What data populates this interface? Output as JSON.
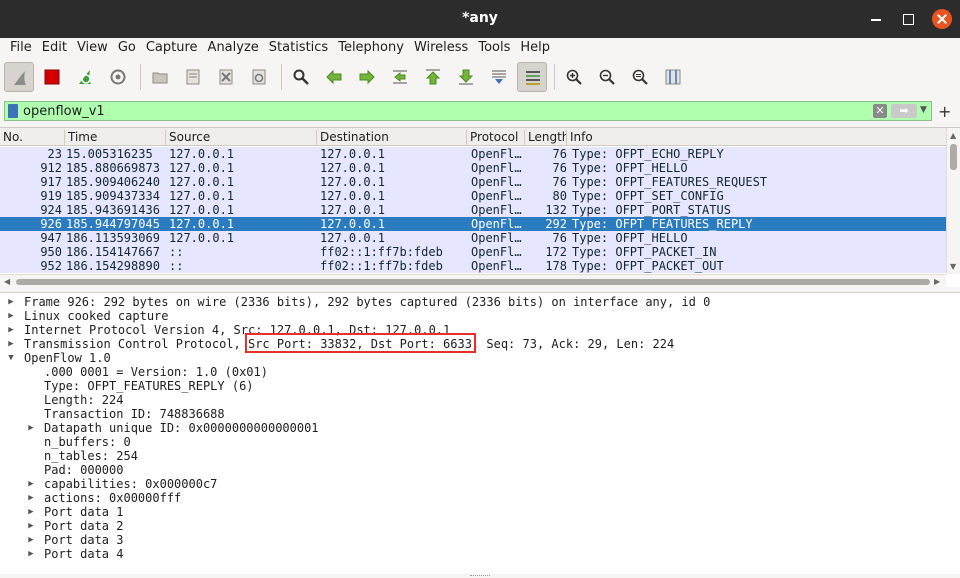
{
  "window": {
    "title": "*any"
  },
  "menu": [
    "File",
    "Edit",
    "View",
    "Go",
    "Capture",
    "Analyze",
    "Statistics",
    "Telephony",
    "Wireless",
    "Tools",
    "Help"
  ],
  "toolbar_icons": [
    "shark-fin-icon",
    "stop-icon",
    "restart-icon",
    "gear-icon",
    "folder-icon",
    "save-file-icon",
    "close-file-icon",
    "reload-icon",
    "find-icon",
    "back-arrow-icon",
    "forward-arrow-icon",
    "goto-packet-icon",
    "first-packet-icon",
    "last-packet-icon",
    "autoscroll-icon",
    "colorize-icon",
    "zoom-in-icon",
    "zoom-out-icon",
    "zoom-normal-icon",
    "resize-columns-icon"
  ],
  "filter": {
    "value": "openflow_v1"
  },
  "packet_list": {
    "columns": [
      "No.",
      "Time",
      "Source",
      "Destination",
      "Protocol",
      "Length",
      "Info"
    ],
    "rows": [
      {
        "no": "23",
        "time": "15.005316235",
        "src": "127.0.0.1",
        "dst": "127.0.0.1",
        "proto": "OpenFl…",
        "len": "76",
        "info": "Type: OFPT_ECHO_REPLY"
      },
      {
        "no": "912",
        "time": "185.880669873",
        "src": "127.0.0.1",
        "dst": "127.0.0.1",
        "proto": "OpenFl…",
        "len": "76",
        "info": "Type: OFPT_HELLO"
      },
      {
        "no": "917",
        "time": "185.909406240",
        "src": "127.0.0.1",
        "dst": "127.0.0.1",
        "proto": "OpenFl…",
        "len": "76",
        "info": "Type: OFPT_FEATURES_REQUEST"
      },
      {
        "no": "919",
        "time": "185.909437334",
        "src": "127.0.0.1",
        "dst": "127.0.0.1",
        "proto": "OpenFl…",
        "len": "80",
        "info": "Type: OFPT_SET_CONFIG"
      },
      {
        "no": "924",
        "time": "185.943691436",
        "src": "127.0.0.1",
        "dst": "127.0.0.1",
        "proto": "OpenFl…",
        "len": "132",
        "info": "Type: OFPT_PORT_STATUS"
      },
      {
        "no": "926",
        "time": "185.944797045",
        "src": "127.0.0.1",
        "dst": "127.0.0.1",
        "proto": "OpenFl…",
        "len": "292",
        "info": "Type: OFPT_FEATURES_REPLY",
        "selected": true
      },
      {
        "no": "947",
        "time": "186.113593069",
        "src": "127.0.0.1",
        "dst": "127.0.0.1",
        "proto": "OpenFl…",
        "len": "76",
        "info": "Type: OFPT_HELLO"
      },
      {
        "no": "950",
        "time": "186.154147667",
        "src": "::",
        "dst": "ff02::1:ff7b:fdeb",
        "proto": "OpenFl…",
        "len": "172",
        "info": "Type: OFPT_PACKET_IN"
      },
      {
        "no": "952",
        "time": "186.154298890",
        "src": "::",
        "dst": "ff02::1:ff7b:fdeb",
        "proto": "OpenFl…",
        "len": "178",
        "info": "Type: OFPT_PACKET_OUT"
      }
    ]
  },
  "details": [
    {
      "indent": 0,
      "arrow": "right",
      "text": "Frame 926: 292 bytes on wire (2336 bits), 292 bytes captured (2336 bits) on interface any, id 0"
    },
    {
      "indent": 0,
      "arrow": "right",
      "text": "Linux cooked capture"
    },
    {
      "indent": 0,
      "arrow": "right",
      "text": "Internet Protocol Version 4, Src: 127.0.0.1, Dst: 127.0.0.1"
    },
    {
      "indent": 0,
      "arrow": "right",
      "text": "Transmission Control Protocol, Src Port: 33832, Dst Port: 6633, Seq: 73, Ack: 29, Len: 224"
    },
    {
      "indent": 0,
      "arrow": "down",
      "text": "OpenFlow 1.0"
    },
    {
      "indent": 1,
      "arrow": "",
      "text": ".000 0001 = Version: 1.0 (0x01)"
    },
    {
      "indent": 1,
      "arrow": "",
      "text": "Type: OFPT_FEATURES_REPLY (6)"
    },
    {
      "indent": 1,
      "arrow": "",
      "text": "Length: 224"
    },
    {
      "indent": 1,
      "arrow": "",
      "text": "Transaction ID: 748836688"
    },
    {
      "indent": 1,
      "arrow": "right",
      "text": "Datapath unique ID: 0x0000000000000001"
    },
    {
      "indent": 1,
      "arrow": "",
      "text": "n_buffers: 0"
    },
    {
      "indent": 1,
      "arrow": "",
      "text": "n_tables: 254"
    },
    {
      "indent": 1,
      "arrow": "",
      "text": "Pad: 000000"
    },
    {
      "indent": 1,
      "arrow": "right",
      "text": "capabilities: 0x000000c7"
    },
    {
      "indent": 1,
      "arrow": "right",
      "text": "actions: 0x00000fff"
    },
    {
      "indent": 1,
      "arrow": "right",
      "text": "Port data 1"
    },
    {
      "indent": 1,
      "arrow": "right",
      "text": "Port data 2"
    },
    {
      "indent": 1,
      "arrow": "right",
      "text": "Port data 3"
    },
    {
      "indent": 1,
      "arrow": "right",
      "text": "Port data 4"
    }
  ],
  "colors": {
    "selected_row": "#2b7bc0",
    "row_bg": "#e7e6ff",
    "filter_ok": "#afffaf",
    "highlight_box": "#e8302a",
    "title_bar": "#2c2c2c"
  }
}
